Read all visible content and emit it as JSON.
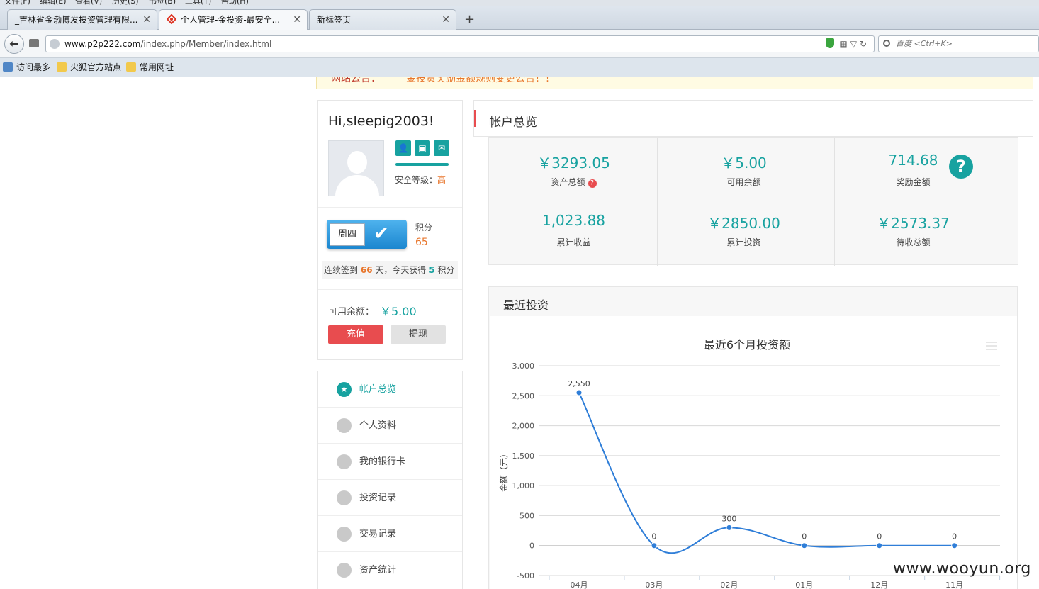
{
  "browser": {
    "menu": [
      "文件(F)",
      "编辑(E)",
      "查看(V)",
      "历史(S)",
      "书签(B)",
      "工具(T)",
      "帮助(H)"
    ],
    "tabs": [
      {
        "title": "_吉林省金渤博发投资管理有限..."
      },
      {
        "title": "个人管理-金投资-最安全..."
      },
      {
        "title": "新标签页"
      }
    ],
    "new_tab": "+",
    "url_host": "www.p2p222.com",
    "url_path": "/index.php/Member/index.html",
    "search_placeholder": "百度 <Ctrl+K>",
    "bookmarks": [
      "访问最多",
      "火狐官方站点",
      "常用网址"
    ]
  },
  "notice": {
    "label": "网站公告：",
    "text": "金投资奖励金额规则变更公告！！"
  },
  "profile": {
    "greeting": "Hi,sleepig2003!",
    "security_label": "安全等级：",
    "security_value": "高",
    "weekday": "周四",
    "points_label": "积分",
    "points_value": "65",
    "streak_pre": "连续签到",
    "streak_days": "66",
    "streak_mid": "天，今天获得",
    "streak_points": "5",
    "streak_post": "积分",
    "balance_label": "可用余额：",
    "balance_value": "￥5.00",
    "recharge": "充值",
    "withdraw": "提现"
  },
  "menu": [
    {
      "label": "帐户总览",
      "active": true
    },
    {
      "label": "个人资料"
    },
    {
      "label": "我的银行卡"
    },
    {
      "label": "投资记录"
    },
    {
      "label": "交易记录"
    },
    {
      "label": "资产统计"
    }
  ],
  "overview": {
    "title": "帐户总览",
    "stats": [
      {
        "value": "￥3293.05",
        "label": "资产总额"
      },
      {
        "value": "￥5.00",
        "label": "可用余额"
      },
      {
        "value": "714.68",
        "label": "奖励金额"
      },
      {
        "value": "1,023.88",
        "label": "累计收益"
      },
      {
        "value": "￥2850.00",
        "label": "累计投资"
      },
      {
        "value": "￥2573.37",
        "label": "待收总额"
      }
    ],
    "help": "?"
  },
  "recent": {
    "title": "最近投资"
  },
  "chart_data": {
    "type": "line",
    "title": "最近6个月投资额",
    "ylabel": "金额（元）",
    "categories": [
      "04月",
      "03月",
      "02月",
      "01月",
      "12月",
      "11月"
    ],
    "values": [
      2550,
      0,
      300,
      0,
      0,
      0
    ],
    "data_labels": [
      "2,550",
      "0",
      "300",
      "0",
      "0",
      "0"
    ],
    "yticks": [
      "3,000",
      "2,500",
      "2,000",
      "1,500",
      "1,000",
      "500",
      "0",
      "-500"
    ],
    "ylim": [
      -500,
      3000
    ],
    "line_color": "#2f7ed8",
    "grid": true
  },
  "watermark": "www.wooyun.org",
  "colors": {
    "accent": "#17a2a0",
    "danger": "#e84c4f",
    "orange": "#e8762c"
  }
}
